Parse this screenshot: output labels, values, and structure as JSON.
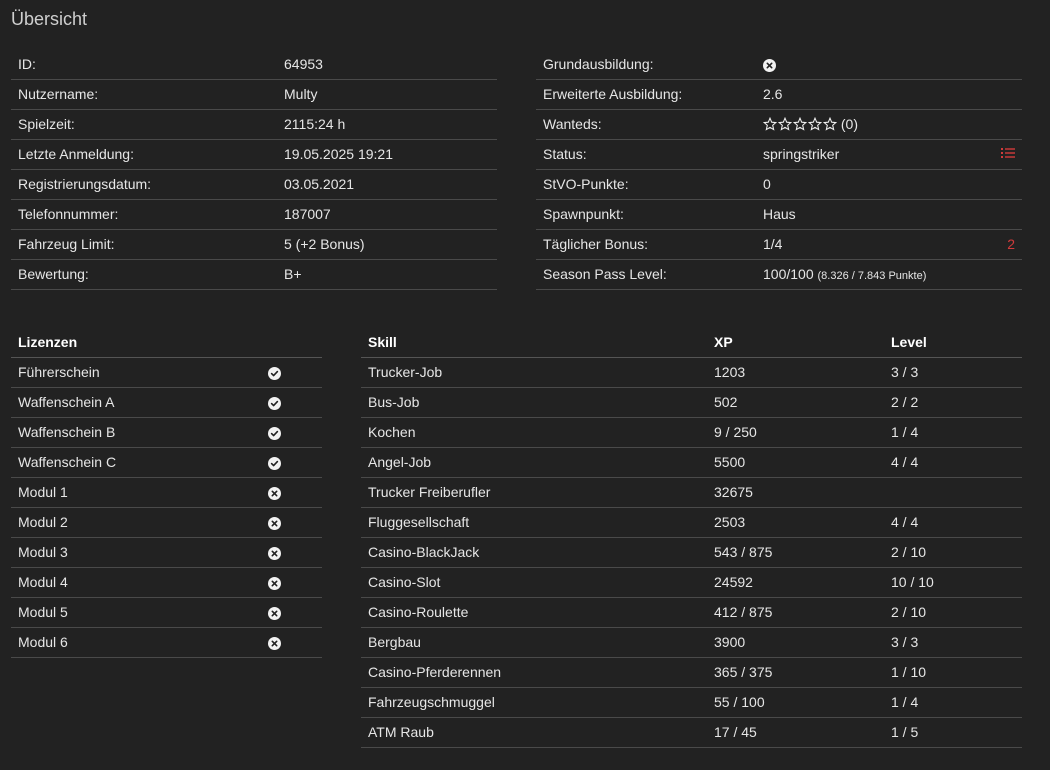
{
  "page_title": "Übersicht",
  "overview_left": [
    {
      "label": "ID:",
      "value": "64953"
    },
    {
      "label": "Nutzername:",
      "value": "Multy"
    },
    {
      "label": "Spielzeit:",
      "value": "2115:24 h"
    },
    {
      "label": "Letzte Anmeldung:",
      "value": "19.05.2025 19:21"
    },
    {
      "label": "Registrierungsdatum:",
      "value": "03.05.2021"
    },
    {
      "label": "Telefonnummer:",
      "value": "187007"
    },
    {
      "label": "Fahrzeug Limit:",
      "value": "5 (+2 Bonus)"
    },
    {
      "label": "Bewertung:",
      "value": "B+"
    }
  ],
  "overview_right": {
    "grundausbildung_label": "Grundausbildung:",
    "grundausbildung_icon": "x-circle-icon",
    "erweitert_label": "Erweiterte Ausbildung:",
    "erweitert_value": "2.6",
    "wanteds_label": "Wanteds:",
    "wanteds_stars_filled": 0,
    "wanteds_stars_total": 5,
    "wanteds_count": "(0)",
    "status_label": "Status:",
    "status_value": "springstriker",
    "status_icon": "list-icon",
    "stvo_label": "StVO-Punkte:",
    "stvo_value": "0",
    "spawn_label": "Spawnpunkt:",
    "spawn_value": "Haus",
    "bonus_label": "Täglicher Bonus:",
    "bonus_value": "1/4",
    "bonus_extra": "2",
    "season_label": "Season Pass Level:",
    "season_value": "100/100",
    "season_points": "(8.326 / 7.843 Punkte)",
    "accent_color": "#d23b3b"
  },
  "licenses": {
    "header": "Lizenzen",
    "items": [
      {
        "name": "Führerschein",
        "status": "check"
      },
      {
        "name": "Waffenschein A",
        "status": "check"
      },
      {
        "name": "Waffenschein B",
        "status": "check"
      },
      {
        "name": "Waffenschein C",
        "status": "check"
      },
      {
        "name": "Modul 1",
        "status": "x"
      },
      {
        "name": "Modul 2",
        "status": "x"
      },
      {
        "name": "Modul 3",
        "status": "x"
      },
      {
        "name": "Modul 4",
        "status": "x"
      },
      {
        "name": "Modul 5",
        "status": "x"
      },
      {
        "name": "Modul 6",
        "status": "x"
      }
    ]
  },
  "skills": {
    "headers": [
      "Skill",
      "XP",
      "Level"
    ],
    "rows": [
      [
        "Trucker-Job",
        "1203",
        "3 / 3"
      ],
      [
        "Bus-Job",
        "502",
        "2 / 2"
      ],
      [
        "Kochen",
        "9 / 250",
        "1 / 4"
      ],
      [
        "Angel-Job",
        "5500",
        "4 / 4"
      ],
      [
        "Trucker Freiberufler",
        "32675",
        ""
      ],
      [
        "Fluggesellschaft",
        "2503",
        "4 / 4"
      ],
      [
        "Casino-BlackJack",
        "543 / 875",
        "2 / 10"
      ],
      [
        "Casino-Slot",
        "24592",
        "10 / 10"
      ],
      [
        "Casino-Roulette",
        "412 / 875",
        "2 / 10"
      ],
      [
        "Bergbau",
        "3900",
        "3 / 3"
      ],
      [
        "Casino-Pferderennen",
        "365 / 375",
        "1 / 10"
      ],
      [
        "Fahrzeugschmuggel",
        "55 / 100",
        "1 / 4"
      ],
      [
        "ATM Raub",
        "17 / 45",
        "1 / 5"
      ]
    ]
  }
}
